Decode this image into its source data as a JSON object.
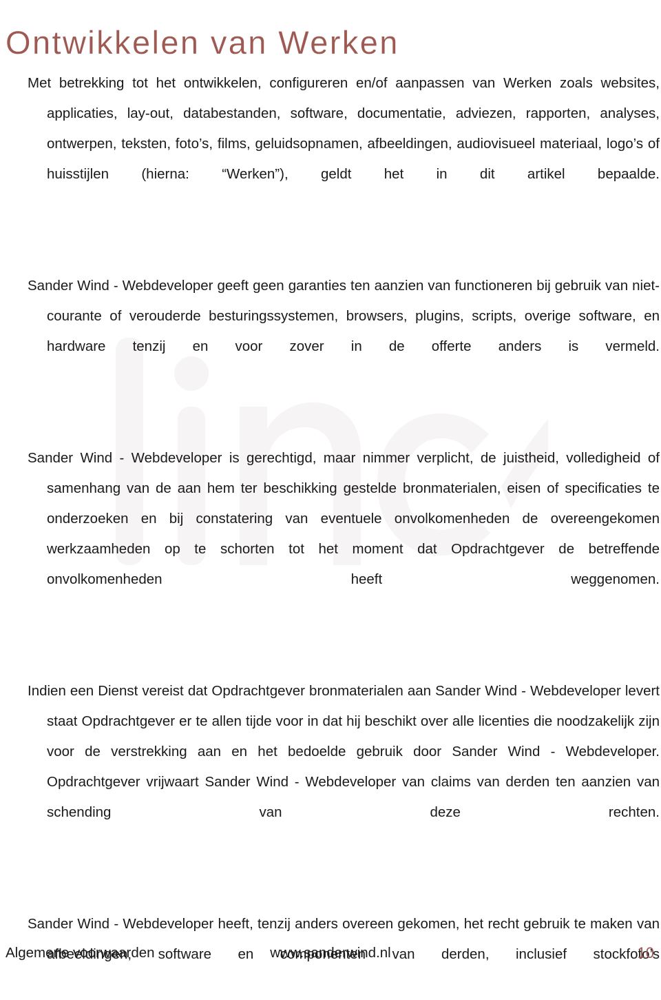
{
  "document": {
    "title": "Ontwikkelen van Werken",
    "title_color": "#9e5a52",
    "body_color": "#1a1a1a",
    "background_color": "#ffffff",
    "watermark_text": "linc"
  },
  "paragraphs": [
    {
      "id": "p1",
      "text": "Met betrekking tot het ontwikkelen, configureren en/of aanpassen van Werken zoals websites, applicaties, lay-out, databestanden, software, documentatie, adviezen, rapporten, analyses, ontwerpen, teksten, foto’s, films, geluidsopnamen, afbeeldingen, audiovisueel materiaal, logo’s of huisstijlen (hierna: “Werken”), geldt het in dit artikel bepaalde."
    },
    {
      "id": "p2",
      "text": "Sander Wind - Webdeveloper geeft geen garanties ten aanzien van functioneren bij gebruik van niet-courante of verouderde besturingssystemen, browsers, plugins, scripts, overige software, en hardware tenzij en voor zover in de offerte anders is vermeld."
    },
    {
      "id": "p3",
      "text": "Sander Wind - Webdeveloper is gerechtigd, maar nimmer verplicht, de juistheid, volledigheid of samenhang van de aan hem ter beschikking gestelde bronmaterialen, eisen of specificaties te onderzoeken en bij constatering van eventuele onvolkomenheden de overeengekomen werkzaamheden op te schorten tot het moment dat Opdrachtgever de betreffende onvolkomenheden heeft weggenomen."
    },
    {
      "id": "p4",
      "text": "Indien een Dienst vereist dat Opdrachtgever bronmaterialen aan Sander Wind - Webdeveloper levert staat Opdrachtgever er te allen tijde voor in dat hij beschikt over alle licenties die noodzakelijk zijn voor de verstrekking aan en het bedoelde gebruik door Sander Wind - Webdeveloper. Opdrachtgever vrijwaart Sander Wind - Webdeveloper van claims van derden ten aanzien van schending van deze rechten."
    },
    {
      "id": "p5",
      "text": "Sander Wind - Webdeveloper heeft, tenzij anders overeen gekomen, het recht gebruik te maken van afbeeldingen, software en componenten van derden, inclusief stockfoto’s"
    }
  ],
  "footer": {
    "left": "Algemene voorwaarden",
    "center": "www.sanderwind.nl",
    "page_number": "10",
    "page_number_color": "#9e5a52"
  }
}
